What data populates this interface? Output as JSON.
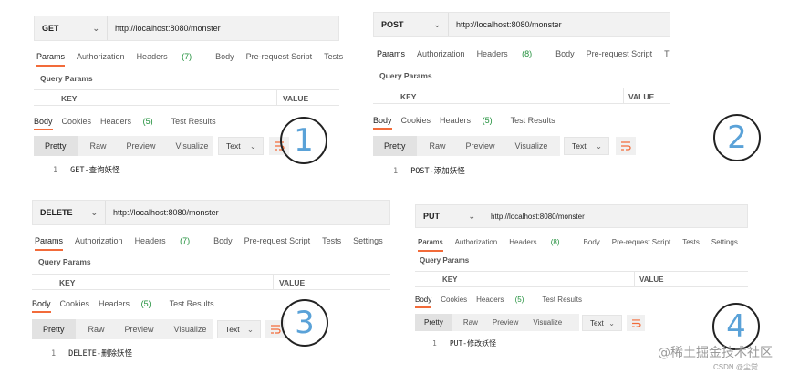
{
  "panels": [
    {
      "method": "GET",
      "url": "http://localhost:8080/monster",
      "tabs": [
        "Params",
        "Authorization",
        "Headers",
        "Body",
        "Pre-request Script",
        "Tests"
      ],
      "headers_count": "(7)",
      "query_params": "Query Params",
      "key_label": "KEY",
      "value_label": "VALUE",
      "response_tabs": [
        "Body",
        "Cookies",
        "Headers",
        "Test Results"
      ],
      "response_headers_count": "(5)",
      "view_options": [
        "Pretty",
        "Raw",
        "Preview",
        "Visualize"
      ],
      "format": "Text",
      "line_number": "1",
      "response_text": "GET-查询妖怪",
      "badge": "1"
    },
    {
      "method": "POST",
      "url": "http://localhost:8080/monster",
      "tabs": [
        "Params",
        "Authorization",
        "Headers",
        "Body",
        "Pre-request Script",
        "T"
      ],
      "headers_count": "(8)",
      "query_params": "Query Params",
      "key_label": "KEY",
      "value_label": "VALUE",
      "response_tabs": [
        "Body",
        "Cookies",
        "Headers",
        "Test Results"
      ],
      "response_headers_count": "(5)",
      "view_options": [
        "Pretty",
        "Raw",
        "Preview",
        "Visualize"
      ],
      "format": "Text",
      "line_number": "1",
      "response_text": "POST-添加妖怪",
      "badge": "2"
    },
    {
      "method": "DELETE",
      "url": "http://localhost:8080/monster",
      "tabs": [
        "Params",
        "Authorization",
        "Headers",
        "Body",
        "Pre-request Script",
        "Tests",
        "Settings"
      ],
      "headers_count": "(7)",
      "query_params": "Query Params",
      "key_label": "KEY",
      "value_label": "VALUE",
      "response_tabs": [
        "Body",
        "Cookies",
        "Headers",
        "Test Results"
      ],
      "response_headers_count": "(5)",
      "view_options": [
        "Pretty",
        "Raw",
        "Preview",
        "Visualize"
      ],
      "format": "Text",
      "line_number": "1",
      "response_text": "DELETE-删除妖怪",
      "badge": "3"
    },
    {
      "method": "PUT",
      "url": "http://localhost:8080/monster",
      "tabs": [
        "Params",
        "Authorization",
        "Headers",
        "Body",
        "Pre-request Script",
        "Tests",
        "Settings"
      ],
      "headers_count": "(8)",
      "query_params": "Query Params",
      "key_label": "KEY",
      "value_label": "VALUE",
      "response_tabs": [
        "Body",
        "Cookies",
        "Headers",
        "Test Results"
      ],
      "response_headers_count": "(5)",
      "view_options": [
        "Pretty",
        "Raw",
        "Preview",
        "Visualize"
      ],
      "format": "Text",
      "line_number": "1",
      "response_text": "PUT-修改妖怪",
      "badge": "4"
    }
  ],
  "watermark": "@稀土掘金技术社区",
  "watermark_small": "CSDN @尘觉",
  "colors": {
    "accent": "#f26b3a",
    "count": "#1f8f3a",
    "badge": "#5aa2d8"
  }
}
